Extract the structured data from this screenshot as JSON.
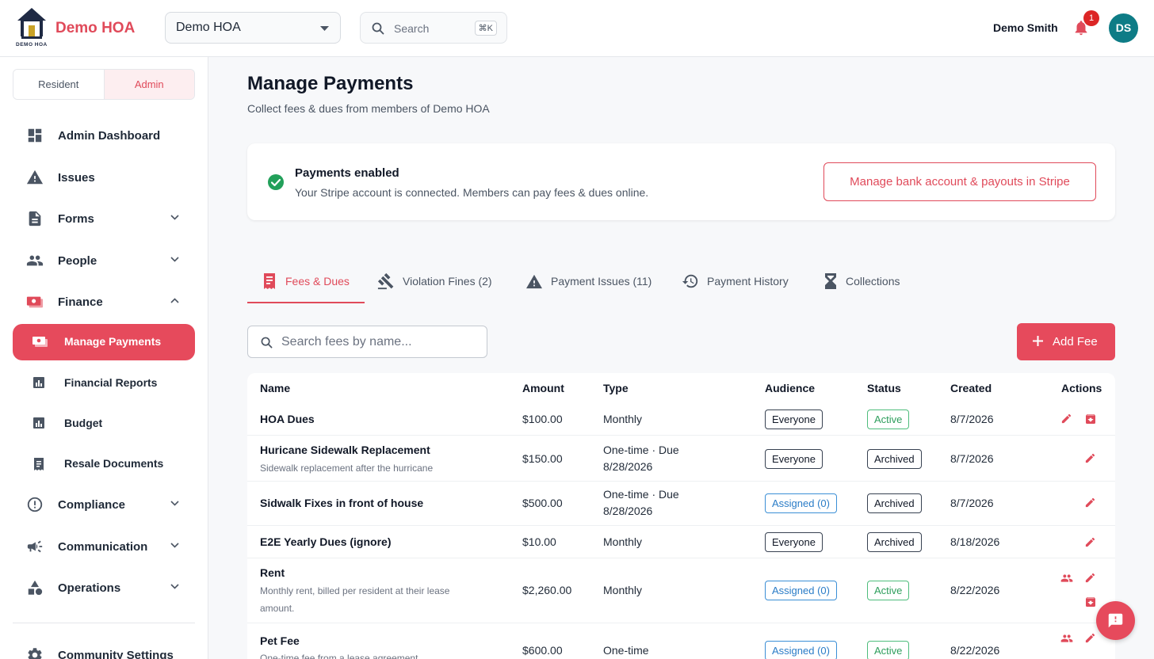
{
  "header": {
    "logo_caption": "DEMO HOA",
    "brand": "Demo HOA",
    "org_selected": "Demo HOA",
    "search_placeholder": "Search",
    "search_shortcut": "⌘K",
    "user_name": "Demo Smith",
    "notification_count": "1",
    "avatar_initials": "DS",
    "avatar_color": "#0e7c86"
  },
  "sidebar": {
    "role_resident": "Resident",
    "role_admin": "Admin",
    "items": [
      {
        "label": "Admin Dashboard",
        "icon": "dashboard-icon"
      },
      {
        "label": "Issues",
        "icon": "warning-icon"
      },
      {
        "label": "Forms",
        "icon": "document-icon"
      },
      {
        "label": "People",
        "icon": "people-icon"
      },
      {
        "label": "Finance",
        "icon": "money-icon"
      },
      {
        "label": "Compliance",
        "icon": "alert-circle-icon"
      },
      {
        "label": "Communication",
        "icon": "megaphone-icon"
      },
      {
        "label": "Operations",
        "icon": "shapes-icon"
      },
      {
        "label": "Community Settings",
        "icon": "gear-icon"
      }
    ],
    "finance_sub": [
      {
        "label": "Manage Payments",
        "icon": "payments-icon"
      },
      {
        "label": "Financial Reports",
        "icon": "bar-chart-icon"
      },
      {
        "label": "Budget",
        "icon": "bar-chart-icon"
      },
      {
        "label": "Resale Documents",
        "icon": "receipt-icon"
      }
    ]
  },
  "main": {
    "title": "Manage Payments",
    "subtitle": "Collect fees & dues from members of Demo HOA",
    "payments_card": {
      "title": "Payments enabled",
      "description": "Your Stripe account is connected. Members can pay fees & dues online.",
      "button": "Manage bank account & payouts in Stripe"
    },
    "tabs": [
      {
        "label": "Fees & Dues",
        "icon": "receipt-icon"
      },
      {
        "label": "Violation Fines (2)",
        "icon": "gavel-icon"
      },
      {
        "label": "Payment Issues (11)",
        "icon": "warning-icon"
      },
      {
        "label": "Payment History",
        "icon": "history-icon"
      },
      {
        "label": "Collections",
        "icon": "hourglass-icon"
      }
    ],
    "fee_search_placeholder": "Search fees by name...",
    "add_button": "Add Fee",
    "table": {
      "columns": [
        "Name",
        "Amount",
        "Type",
        "Audience",
        "Status",
        "Created",
        "Actions"
      ],
      "rows": [
        {
          "name": "HOA Dues",
          "desc": "",
          "amount": "$100.00",
          "type1": "Monthly",
          "type2": "",
          "audience": "Everyone",
          "status": "Active",
          "created": "8/7/2026"
        },
        {
          "name": "Huricane Sidewalk Replacement",
          "desc": "Sidewalk replacement after the hurricane",
          "amount": "$150.00",
          "type1": "One-time · Due",
          "type2": "8/28/2026",
          "audience": "Everyone",
          "status": "Archived",
          "created": "8/7/2026"
        },
        {
          "name": "Sidwalk Fixes in front of house",
          "desc": "",
          "amount": "$500.00",
          "type1": "One-time · Due",
          "type2": "8/28/2026",
          "audience": "Assigned (0)",
          "status": "Archived",
          "created": "8/7/2026"
        },
        {
          "name": "E2E Yearly Dues (ignore)",
          "desc": "",
          "amount": "$10.00",
          "type1": "Monthly",
          "type2": "",
          "audience": "Everyone",
          "status": "Archived",
          "created": "8/18/2026"
        },
        {
          "name": "Rent",
          "desc1": "Monthly rent, billed per resident at their lease",
          "desc2": "amount.",
          "amount": "$2,260.00",
          "type1": "Monthly",
          "type2": "",
          "audience": "Assigned (0)",
          "status": "Active",
          "created": "8/22/2026"
        },
        {
          "name": "Pet Fee",
          "desc": "One-time fee from a lease agreement",
          "amount": "$600.00",
          "type1": "One-time",
          "type2": "",
          "audience": "Assigned (0)",
          "status": "Active",
          "created": "8/22/2026"
        }
      ]
    }
  },
  "colors": {
    "accent": "#e64a5c",
    "active_green": "#2e9e5c",
    "assigned_blue": "#2a7cc7"
  }
}
